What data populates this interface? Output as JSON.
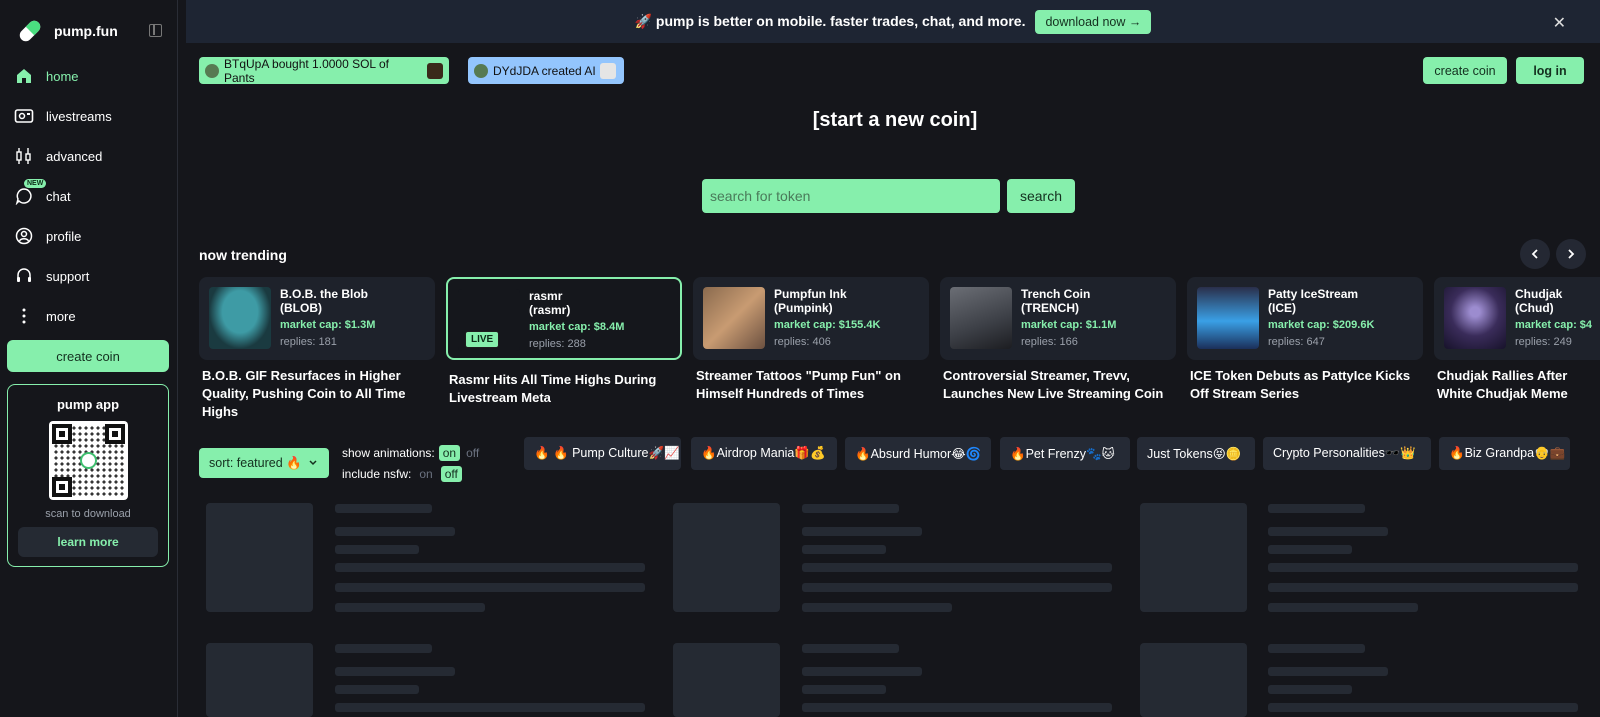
{
  "sidebar": {
    "logo_text": "pump.fun",
    "nav": [
      {
        "label": "home",
        "icon": "home-icon",
        "active": true
      },
      {
        "label": "livestreams",
        "icon": "livestream-icon"
      },
      {
        "label": "advanced",
        "icon": "candles-icon"
      },
      {
        "label": "chat",
        "icon": "chat-icon",
        "badge": "NEW"
      },
      {
        "label": "profile",
        "icon": "profile-icon"
      },
      {
        "label": "support",
        "icon": "headset-icon"
      },
      {
        "label": "more",
        "icon": "more-icon"
      }
    ],
    "create_coin": "create coin",
    "app": {
      "title": "pump app",
      "scan_text": "scan to download",
      "learn_more": "learn more"
    }
  },
  "banner": {
    "text": "🚀 pump is better on mobile. faster trades, chat, and more.",
    "button": "download now →",
    "close": "✕"
  },
  "ticker": [
    {
      "text": "BTqUpA bought 1.0000 SOL of Pants"
    },
    {
      "text": "DYdJDA created AI"
    }
  ],
  "header": {
    "create_coin": "create coin",
    "login": "log in"
  },
  "start_coin": "[start a new coin]",
  "search": {
    "placeholder": "search for token",
    "button": "search"
  },
  "trending": {
    "title": "now trending",
    "cards": [
      {
        "name": "B.O.B. the Blob\n(BLOB)",
        "cap": "market cap: $1.3M",
        "replies": "replies: 181",
        "desc": "B.O.B. GIF Resurfaces in Higher Quality, Pushing Coin to All Time Highs"
      },
      {
        "name": "rasmr\n(rasmr)",
        "cap": "market cap: $8.4M",
        "replies": "replies: 288",
        "live": "LIVE",
        "desc": "Rasmr Hits All Time Highs During Livestream Meta"
      },
      {
        "name": "Pumpfun Ink\n(Pumpink)",
        "cap": "market cap: $155.4K",
        "replies": "replies: 406",
        "desc": "Streamer Tattoos \"Pump Fun\" on Himself Hundreds of Times"
      },
      {
        "name": "Trench Coin\n(TRENCH)",
        "cap": "market cap: $1.1M",
        "replies": "replies: 166",
        "desc": "Controversial Streamer, Trevv, Launches New Live Streaming Coin"
      },
      {
        "name": "Patty IceStream\n(ICE)",
        "cap": "market cap: $209.6K",
        "replies": "replies: 647",
        "desc": "ICE Token Debuts as PattyIce Kicks Off Stream Series"
      },
      {
        "name": "Chudjak\n(Chud)",
        "cap": "market cap: $4",
        "replies": "replies: 249",
        "desc": "Chudjak Rallies After White Chudjak Meme"
      }
    ]
  },
  "filters": {
    "sort": "sort: featured 🔥",
    "show_animations_label": "show animations:",
    "include_nsfw_label": "include nsfw:",
    "on": "on",
    "off": "off",
    "chips": [
      "🔥 🔥 Pump Culture🚀📈",
      "🔥Airdrop Mania🎁💰",
      "🔥Absurd Humor😂🌀",
      "🔥Pet Frenzy🐾🐱",
      "Just Tokens😝🪙",
      "Crypto Personalities🕶️👑",
      "🔥Biz Grandpa👴💼"
    ]
  },
  "colors": {
    "accent": "#86efac",
    "background": "#15161b",
    "card": "#1e222b",
    "live_blue": "#93c5fd"
  }
}
